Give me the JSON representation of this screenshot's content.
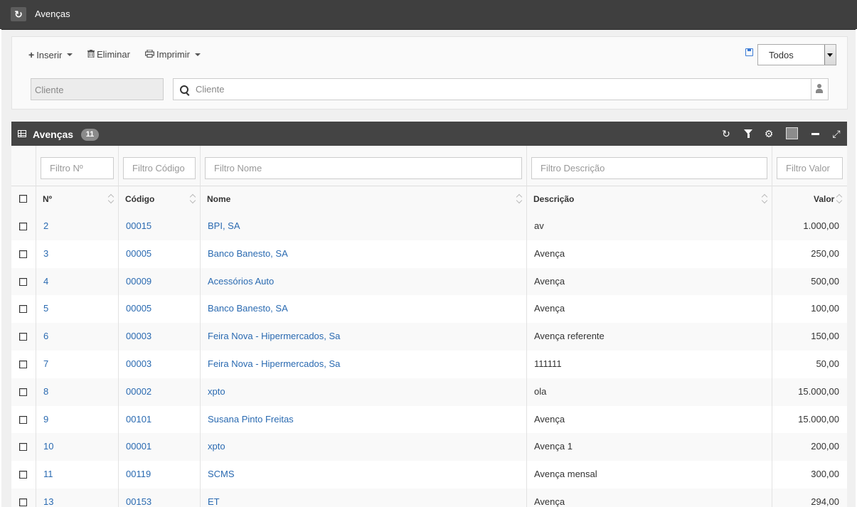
{
  "app": {
    "title": "Avenças"
  },
  "toolbar": {
    "insert_label": "Inserir",
    "delete_label": "Eliminar",
    "print_label": "Imprimir",
    "filter_select_value": "Todos"
  },
  "client_filter": {
    "code_placeholder": "Cliente",
    "search_placeholder": "Cliente"
  },
  "panel": {
    "title": "Avenças",
    "count": "11"
  },
  "filters": {
    "numero": "Filtro Nº",
    "codigo": "Filtro Código",
    "nome": "Filtro Nome",
    "descricao": "Filtro Descrição",
    "valor": "Filtro Valor"
  },
  "columns": {
    "numero": "Nº",
    "codigo": "Código",
    "nome": "Nome",
    "descricao": "Descrição",
    "valor": "Valor"
  },
  "rows": [
    {
      "numero": "2",
      "codigo": "00015",
      "nome": "BPI, SA",
      "descricao": "av",
      "valor": "1.000,00"
    },
    {
      "numero": "3",
      "codigo": "00005",
      "nome": "Banco Banesto, SA",
      "descricao": "Avença",
      "valor": "250,00"
    },
    {
      "numero": "4",
      "codigo": "00009",
      "nome": "Acessórios Auto",
      "descricao": "Avença",
      "valor": "500,00"
    },
    {
      "numero": "5",
      "codigo": "00005",
      "nome": "Banco Banesto, SA",
      "descricao": "Avença",
      "valor": "100,00"
    },
    {
      "numero": "6",
      "codigo": "00003",
      "nome": "Feira Nova - Hipermercados, Sa",
      "descricao": "Avença referente",
      "valor": "150,00"
    },
    {
      "numero": "7",
      "codigo": "00003",
      "nome": "Feira Nova - Hipermercados, Sa",
      "descricao": "111111",
      "valor": "50,00"
    },
    {
      "numero": "8",
      "codigo": "00002",
      "nome": "xpto",
      "descricao": "ola",
      "valor": "15.000,00"
    },
    {
      "numero": "9",
      "codigo": "00101",
      "nome": "Susana Pinto Freitas",
      "descricao": "Avença",
      "valor": "15.000,00"
    },
    {
      "numero": "10",
      "codigo": "00001",
      "nome": "xpto",
      "descricao": "Avença 1",
      "valor": "200,00"
    },
    {
      "numero": "11",
      "codigo": "00119",
      "nome": "SCMS",
      "descricao": "Avença mensal",
      "valor": "300,00"
    },
    {
      "numero": "13",
      "codigo": "00153",
      "nome": "ET",
      "descricao": "Avença",
      "valor": "294,00"
    }
  ],
  "icons": {
    "app": "refresh-icon",
    "insert": "plus-icon",
    "delete": "trash-icon",
    "print": "print-icon",
    "save": "save-icon",
    "search": "search-icon",
    "client_lookup": "person-icon",
    "panel": "table-icon",
    "panel_refresh": "refresh-icon",
    "panel_filter": "filter-icon",
    "panel_settings": "gear-icon",
    "panel_color": "color-square-icon",
    "panel_minimize": "minus-icon",
    "panel_fullscreen": "expand-icon"
  },
  "colors": {
    "topbar": "#3f3f3f",
    "panel_header": "#444444",
    "link": "#2a6ab1",
    "badge": "#8a8a8a"
  }
}
